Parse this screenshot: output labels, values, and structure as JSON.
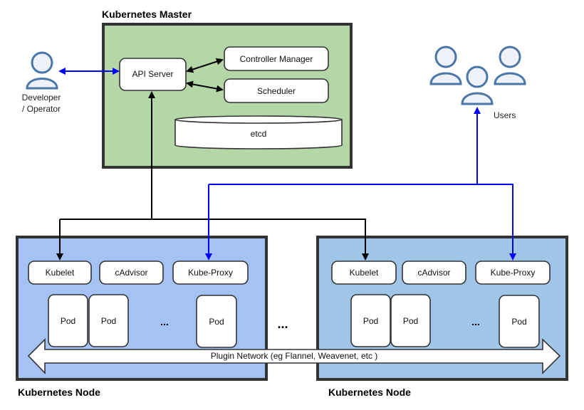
{
  "master": {
    "title": "Kubernetes Master",
    "api_server": "API Server",
    "controller_manager": "Controller Manager",
    "scheduler": "Scheduler",
    "etcd": "etcd",
    "fill": "#b5d6a7"
  },
  "developer": {
    "label_line1": "Developer",
    "label_line2": "/ Operator"
  },
  "users": {
    "label": "Users"
  },
  "nodes": [
    {
      "title": "Kubernetes Node",
      "fill": "#a4c2f4",
      "kubelet": "Kubelet",
      "cadvisor": "cAdvisor",
      "kube_proxy": "Kube-Proxy",
      "pods": [
        "Pod",
        "Pod",
        "Pod"
      ],
      "ellipsis": "..."
    },
    {
      "title": "Kubernetes Node",
      "fill": "#9fc5e8",
      "kubelet": "Kubelet",
      "cadvisor": "cAdvisor",
      "kube_proxy": "Kube-Proxy",
      "pods": [
        "Pod",
        "Pod",
        "Pod"
      ],
      "ellipsis": "..."
    }
  ],
  "between_nodes_ellipsis": "...",
  "network": {
    "label": "Plugin Network (eg Flannel, Weavenet, etc )"
  },
  "colors": {
    "control_arrow": "#000000",
    "user_arrow": "#0000ff",
    "person_stroke": "#4a76a8"
  }
}
